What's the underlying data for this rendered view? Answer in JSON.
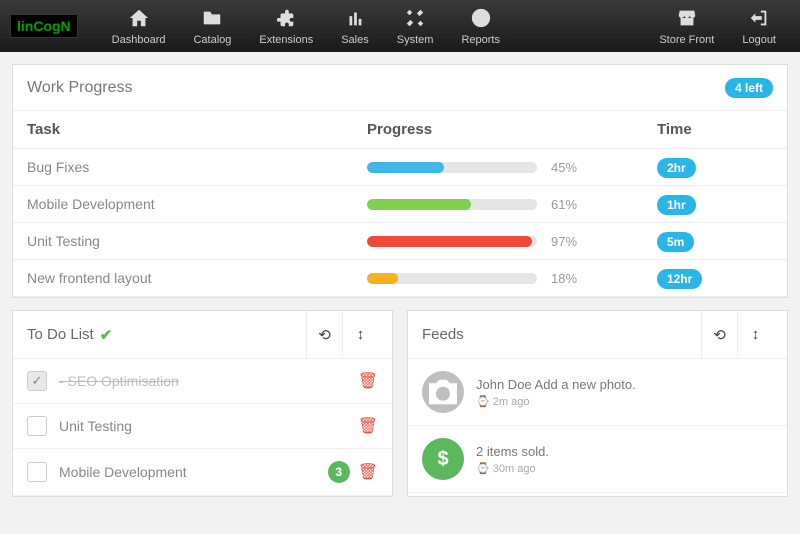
{
  "brand": "linCogN",
  "nav": {
    "items": [
      {
        "label": "Dashboard",
        "icon": "home"
      },
      {
        "label": "Catalog",
        "icon": "folder"
      },
      {
        "label": "Extensions",
        "icon": "puzzle"
      },
      {
        "label": "Sales",
        "icon": "coins"
      },
      {
        "label": "System",
        "icon": "wrench"
      },
      {
        "label": "Reports",
        "icon": "pie"
      }
    ],
    "right": [
      {
        "label": "Store Front",
        "icon": "store"
      },
      {
        "label": "Logout",
        "icon": "logout"
      }
    ]
  },
  "work_progress": {
    "title": "Work Progress",
    "badge": "4 left",
    "headers": {
      "task": "Task",
      "progress": "Progress",
      "time": "Time"
    },
    "rows": [
      {
        "task": "Bug Fixes",
        "pct": 45,
        "pct_label": "45%",
        "time": "2hr",
        "color": "#42b7e6"
      },
      {
        "task": "Mobile Development",
        "pct": 61,
        "pct_label": "61%",
        "time": "1hr",
        "color": "#7fd04b"
      },
      {
        "task": "Unit Testing",
        "pct": 97,
        "pct_label": "97%",
        "time": "5m",
        "color": "#ef4a3c"
      },
      {
        "task": "New frontend layout",
        "pct": 18,
        "pct_label": "18%",
        "time": "12hr",
        "color": "#f5b122"
      }
    ]
  },
  "todo": {
    "title": "To Do List",
    "items": [
      {
        "label": "SEO Optimisation",
        "checked": true,
        "strike": true,
        "badge": null
      },
      {
        "label": "Unit Testing",
        "checked": false,
        "strike": false,
        "badge": null
      },
      {
        "label": "Mobile Development",
        "checked": false,
        "strike": false,
        "badge": "3"
      }
    ]
  },
  "feeds": {
    "title": "Feeds",
    "items": [
      {
        "text": "John Doe Add a new photo.",
        "time": "2m ago",
        "icon": "camera",
        "bg": "gray"
      },
      {
        "text": "2 items sold.",
        "time": "30m ago",
        "icon": "dollar",
        "bg": "green"
      }
    ]
  }
}
